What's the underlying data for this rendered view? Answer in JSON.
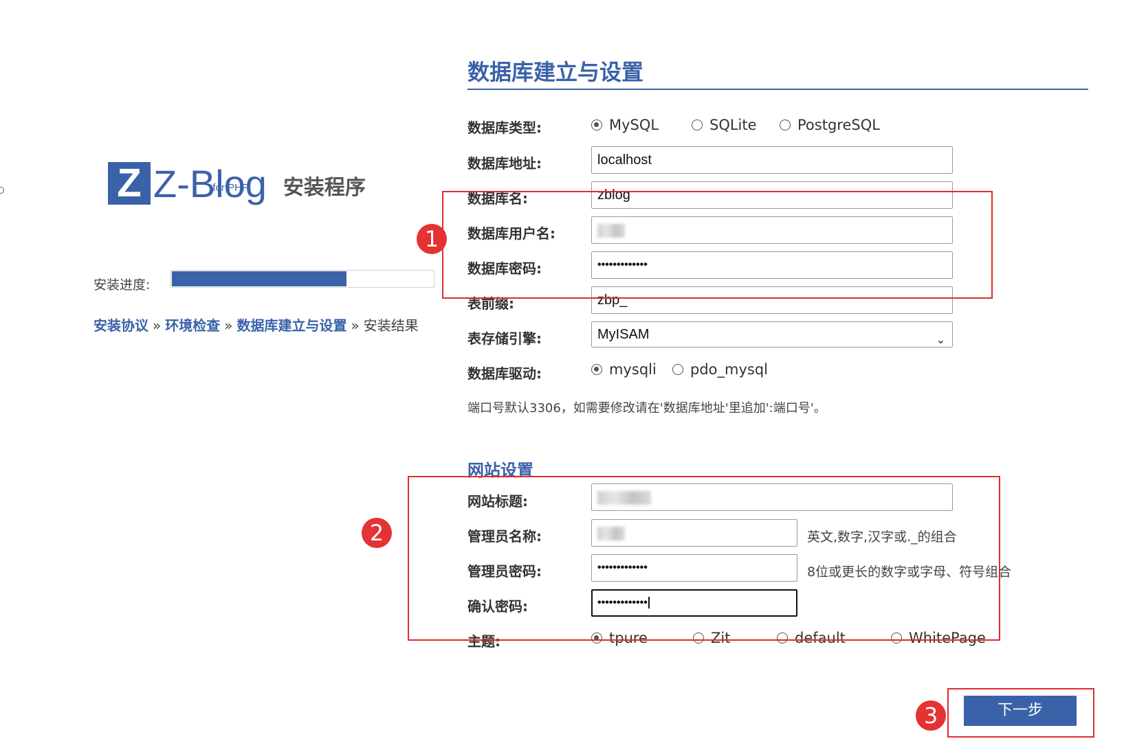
{
  "app": {
    "logo_letter": "Z",
    "logo_name": "Z-Blog",
    "logo_sub": "for PHP",
    "installer_title": "安装程序"
  },
  "progress": {
    "label": "安装进度:",
    "value_fraction": 0.67
  },
  "breadcrumb": {
    "steps": [
      "安装协议",
      "环境检查",
      "数据库建立与设置",
      "安装结果"
    ],
    "separator": "»"
  },
  "section_db": {
    "title": "数据库建立与设置",
    "db_type": {
      "label": "数据库类型:",
      "options": [
        "MySQL",
        "SQLite",
        "PostgreSQL"
      ],
      "selected": "MySQL"
    },
    "db_host": {
      "label": "数据库地址:",
      "value": "localhost"
    },
    "db_name": {
      "label": "数据库名:",
      "value": "zblog"
    },
    "db_user": {
      "label": "数据库用户名:",
      "value": ""
    },
    "db_password": {
      "label": "数据库密码:",
      "value": "•••••••••••••"
    },
    "table_prefix": {
      "label": "表前缀:",
      "value": "zbp_"
    },
    "engine": {
      "label": "表存储引擎:",
      "value": "MyISAM"
    },
    "driver": {
      "label": "数据库驱动:",
      "options": [
        "mysqli",
        "pdo_mysql"
      ],
      "selected": "mysqli"
    },
    "port_hint": "端口号默认3306，如需要修改请在'数据库地址'里追加':端口号'。"
  },
  "section_site": {
    "title": "网站设置",
    "site_title": {
      "label": "网站标题:",
      "value": ""
    },
    "admin_name": {
      "label": "管理员名称:",
      "value": "",
      "hint": "英文,数字,汉字或._的组合"
    },
    "admin_password": {
      "label": "管理员密码:",
      "value": "•••••••••••••",
      "hint": "8位或更长的数字或字母、符号组合"
    },
    "confirm_password": {
      "label": "确认密码:",
      "value": "•••••••••••••"
    },
    "theme": {
      "label": "主题:",
      "options": [
        "tpure",
        "Zit",
        "default",
        "WhitePage"
      ],
      "selected": "tpure"
    }
  },
  "annotations": {
    "badge_1": "1",
    "badge_2": "2",
    "badge_3": "3",
    "color": "#e02b2b"
  },
  "next_button": {
    "label": "下一步"
  },
  "colors": {
    "brand": "#3a62a8"
  }
}
